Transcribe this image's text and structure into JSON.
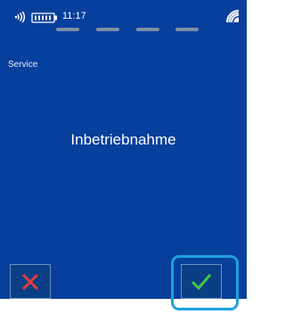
{
  "status_bar": {
    "time": "11:17",
    "icons": [
      "nfc-icon",
      "battery-icon",
      "signal-icon"
    ]
  },
  "progress": {
    "steps": 4
  },
  "screen": {
    "section_label": "Service",
    "message": "Inbetriebnahme"
  },
  "buttons": {
    "cancel_icon": "close-icon",
    "confirm_icon": "checkmark-icon"
  },
  "colors": {
    "background": "#063f9c",
    "cancel": "#e33a3d",
    "confirm": "#43c84a",
    "highlight": "#1ea2df"
  }
}
